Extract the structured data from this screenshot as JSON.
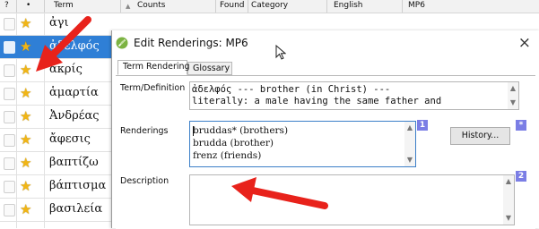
{
  "grid": {
    "columns": [
      "?",
      "•",
      "Term",
      "Counts",
      "Found",
      "Category",
      "English",
      "MP6"
    ],
    "rows": [
      {
        "term": "ἀγι"
      },
      {
        "term": "ἀδελφός",
        "selected": true
      },
      {
        "term": "ἀκρίς"
      },
      {
        "term": "ἁμαρτία"
      },
      {
        "term": "Ἀνδρέας"
      },
      {
        "term": "ἄφεσις"
      },
      {
        "term": "βαπτίζω"
      },
      {
        "term": "βάπτισμα"
      },
      {
        "term": "βασιλεία"
      }
    ]
  },
  "dialog": {
    "title": "Edit Renderings: MP6",
    "tabs": [
      "Term Rendering",
      "Glossary"
    ],
    "labels": {
      "term_definition": "Term/Definition",
      "renderings": "Renderings",
      "description": "Description"
    },
    "definition_lines": [
      "ἀδελφός --- brother (in Christ) ---",
      "literally: a male having the same father and"
    ],
    "renderings_lines": [
      "bruddas* (brothers)",
      "brudda (brother)",
      "frenz (friends)"
    ],
    "badges": [
      "1",
      "*",
      "2"
    ],
    "history_button": "History...",
    "description_value": ""
  },
  "colors": {
    "selection": "#2f7fd6",
    "star": "#f1b515",
    "badge": "#7b7ee5",
    "annotation_arrow": "#e8221b"
  }
}
